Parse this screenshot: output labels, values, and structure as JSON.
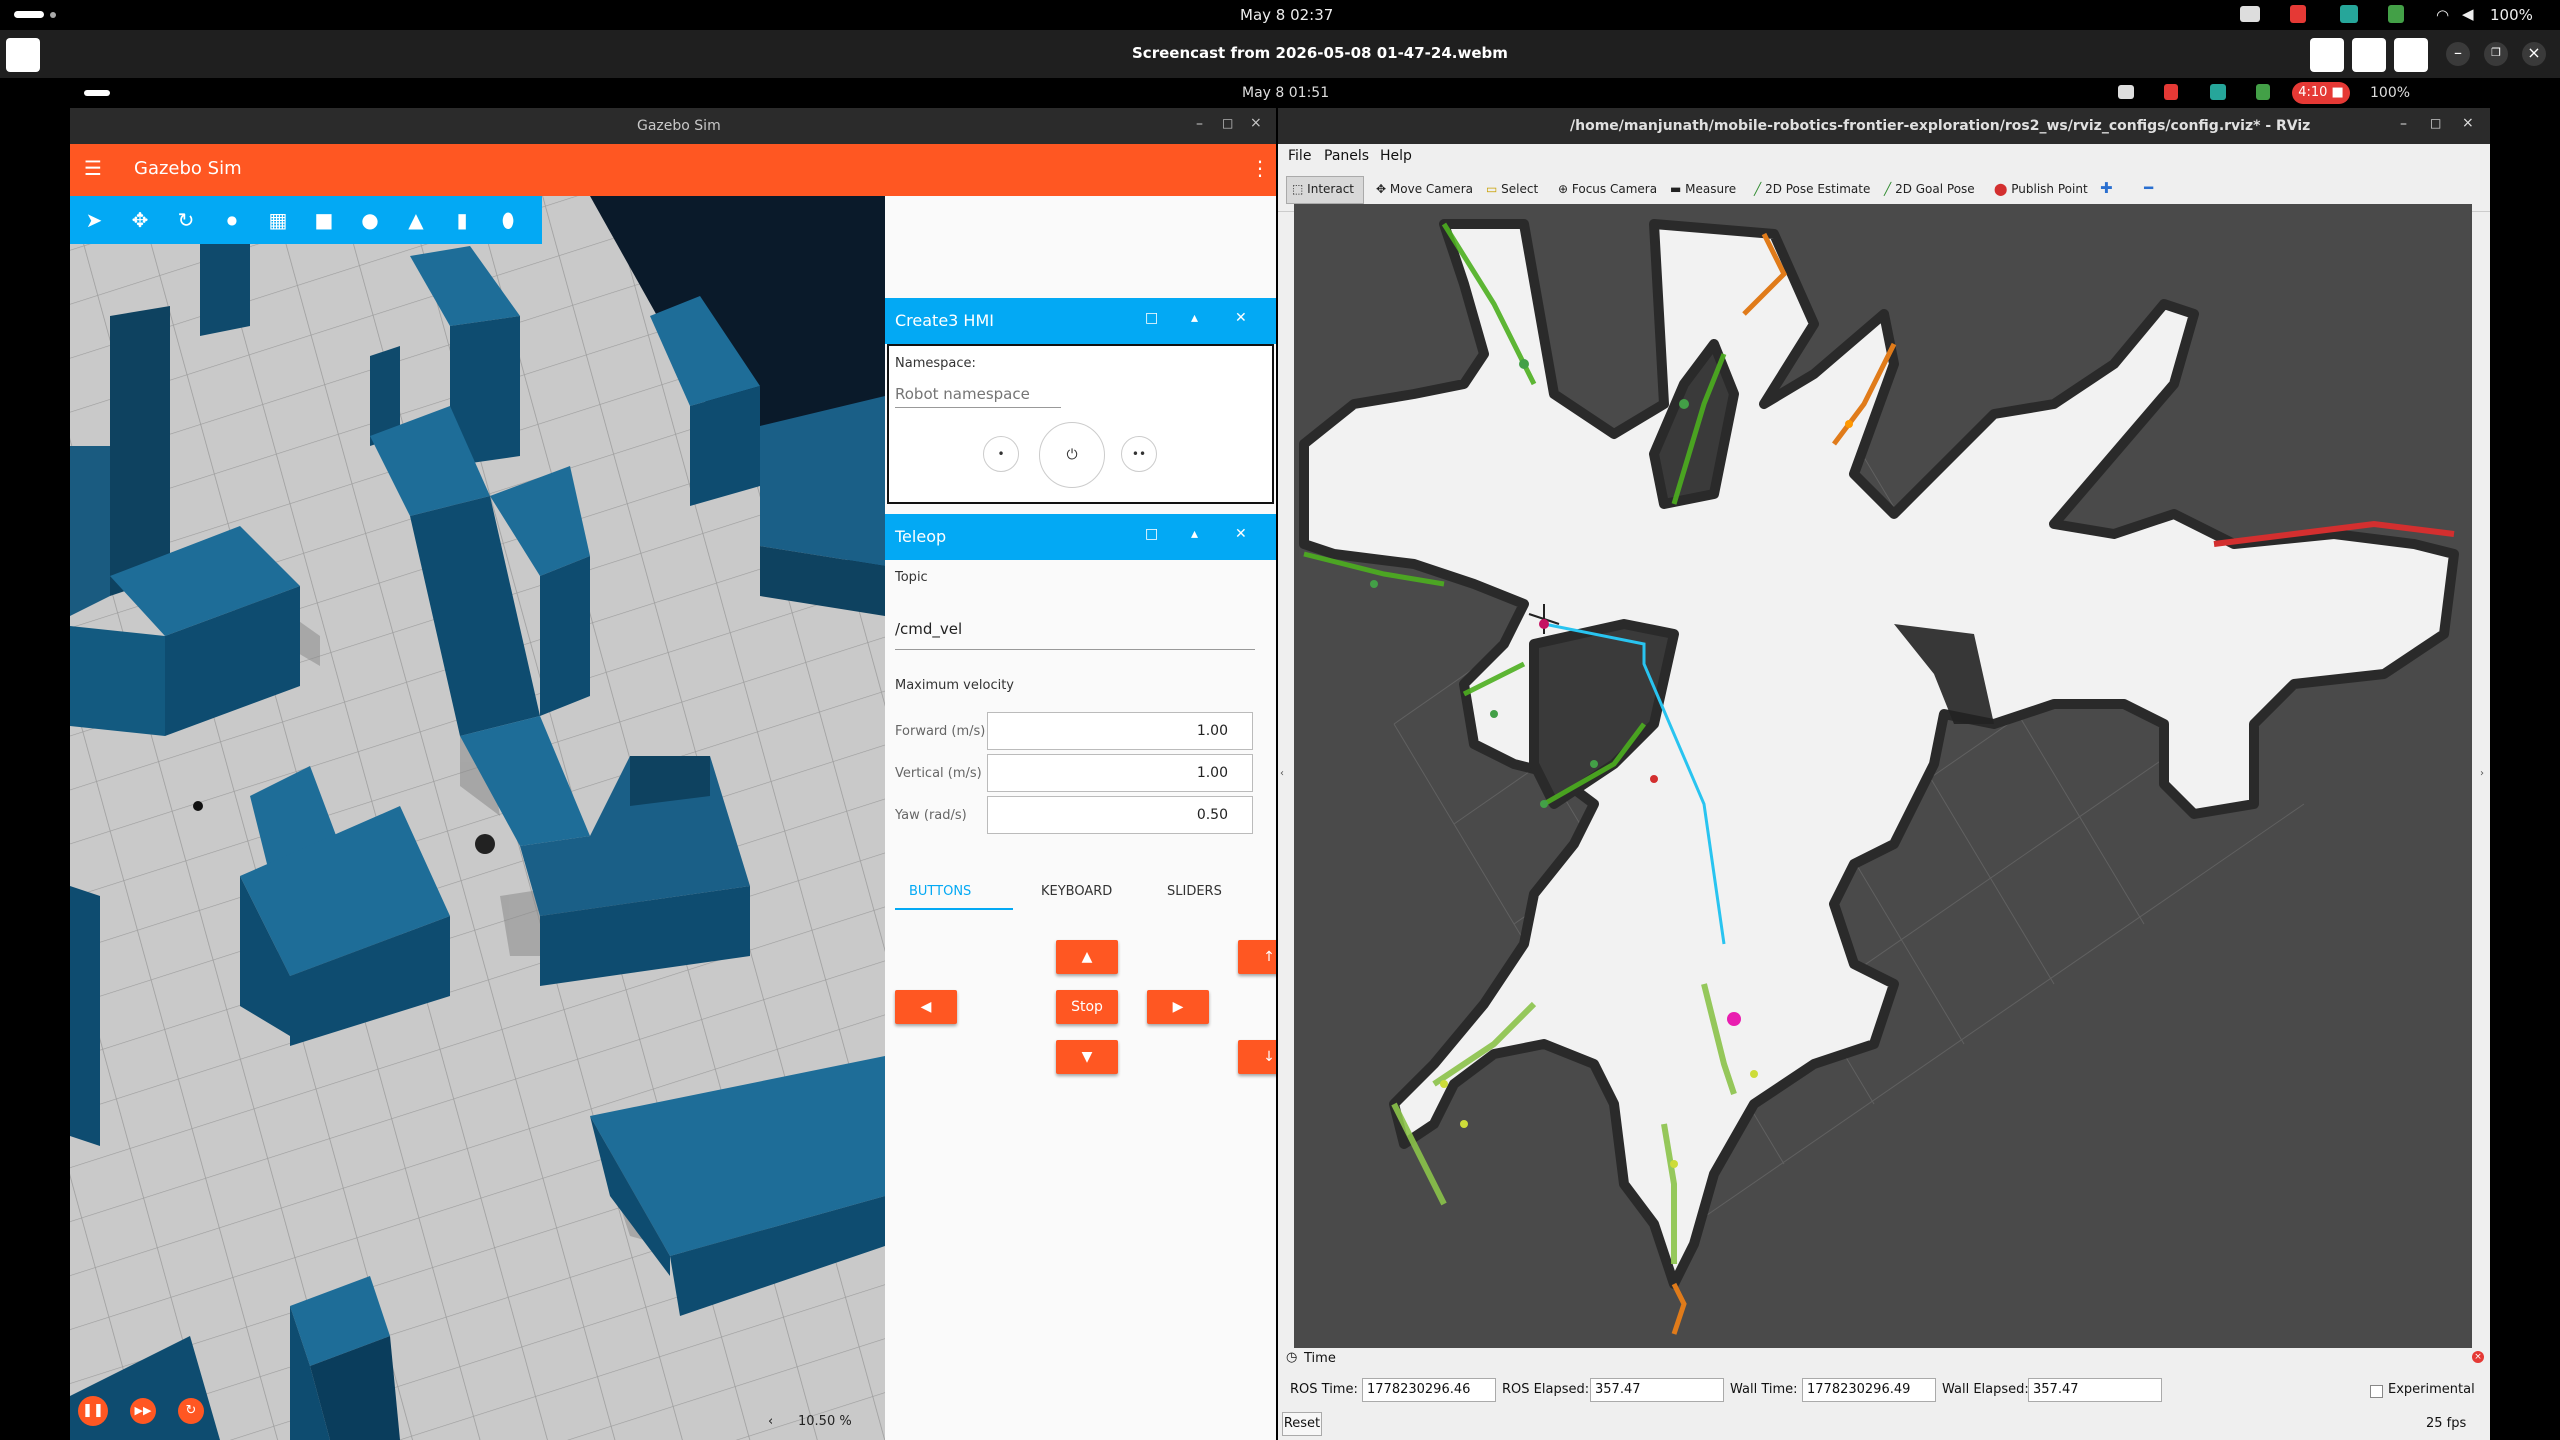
{
  "topbar": {
    "date": "May 8  02:37",
    "battery": "100%"
  },
  "screencast": {
    "title": "Screencast from 2026-05-08 01-47-24.webm"
  },
  "innerbar": {
    "date": "May 8  01:51",
    "record": "4:10",
    "battery": "100%"
  },
  "gazebo": {
    "window_title": "Gazebo Sim",
    "app_title": "Gazebo Sim",
    "zoom": "10.50 %",
    "hmi": {
      "title": "Create3 HMI",
      "namespace_label": "Namespace:",
      "namespace_placeholder": "Robot namespace"
    },
    "teleop": {
      "title": "Teleop",
      "topic_label": "Topic",
      "topic_value": "/cmd_vel",
      "maxvel_label": "Maximum velocity",
      "forward_label": "Forward (m/s)",
      "forward_value": "1.00",
      "vertical_label": "Vertical (m/s)",
      "vertical_value": "1.00",
      "yaw_label": "Yaw (rad/s)",
      "yaw_value": "0.50",
      "tabs": [
        "BUTTONS",
        "KEYBOARD",
        "SLIDERS"
      ],
      "stop_label": "Stop",
      "up_arrow": "▲",
      "down_arrow": "▼",
      "left_arrow": "◀",
      "right_arrow": "▶",
      "ascend": "↑",
      "descend": "↓"
    }
  },
  "rviz": {
    "window_title": "/home/manjunath/mobile-robotics-frontier-exploration/ros2_ws/rviz_configs/config.rviz* - RViz",
    "menu": [
      "File",
      "Panels",
      "Help"
    ],
    "tools": [
      "Interact",
      "Move Camera",
      "Select",
      "Focus Camera",
      "Measure",
      "2D Pose Estimate",
      "2D Goal Pose",
      "Publish Point"
    ],
    "time": {
      "panel_title": "Time",
      "ros_time_label": "ROS Time:",
      "ros_time": "1778230296.46",
      "ros_elapsed_label": "ROS Elapsed:",
      "ros_elapsed": "357.47",
      "wall_time_label": "Wall Time:",
      "wall_time": "1778230296.49",
      "wall_elapsed_label": "Wall Elapsed:",
      "wall_elapsed": "357.47",
      "experimental": "Experimental",
      "reset": "Reset",
      "fps": "25 fps"
    }
  },
  "colors": {
    "gazebo_orange": "#ff5722",
    "gazebo_blue": "#03a9f4",
    "path_cyan": "#29c4f0"
  }
}
